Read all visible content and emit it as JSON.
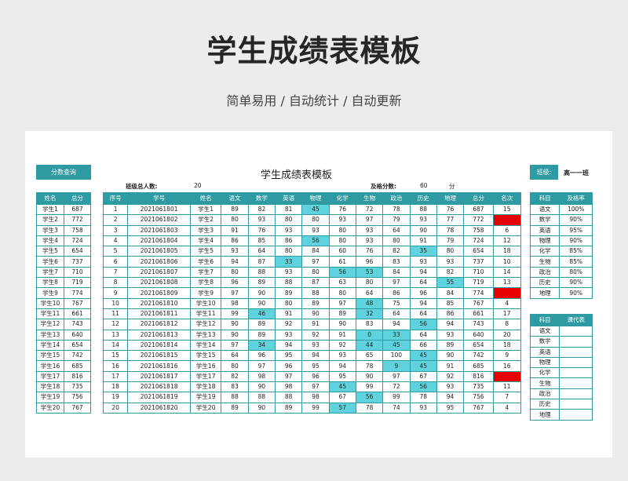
{
  "header": {
    "title": "学生成绩表模板",
    "subtitle": "简单易用  /  自动统计  /  自动更新"
  },
  "sheet": {
    "title": "学生成绩表模板",
    "score_query_button": "分数查询",
    "class_label": "班级:",
    "class_value": "高一一班",
    "total_label": "班级总人数:",
    "total_value": "20",
    "pass_label": "及格分数:",
    "pass_value": "60",
    "pass_unit": "分"
  },
  "left_table": {
    "headers": [
      "姓名",
      "总分"
    ],
    "rows": [
      [
        "学生1",
        "687"
      ],
      [
        "学生2",
        "772"
      ],
      [
        "学生3",
        "758"
      ],
      [
        "学生4",
        "724"
      ],
      [
        "学生5",
        "654"
      ],
      [
        "学生6",
        "737"
      ],
      [
        "学生7",
        "710"
      ],
      [
        "学生8",
        "719"
      ],
      [
        "学生9",
        "774"
      ],
      [
        "学生10",
        "767"
      ],
      [
        "学生11",
        "661"
      ],
      [
        "学生12",
        "743"
      ],
      [
        "学生13",
        "640"
      ],
      [
        "学生14",
        "654"
      ],
      [
        "学生15",
        "742"
      ],
      [
        "学生16",
        "685"
      ],
      [
        "学生17",
        "816"
      ],
      [
        "学生18",
        "735"
      ],
      [
        "学生19",
        "756"
      ],
      [
        "学生20",
        "767"
      ]
    ]
  },
  "main_table": {
    "headers": [
      "序号",
      "学号",
      "姓名",
      "语文",
      "数学",
      "英语",
      "物理",
      "化学",
      "生物",
      "政治",
      "历史",
      "地理",
      "总分",
      "名次"
    ],
    "rows": [
      [
        "1",
        "2021061801",
        "学生1",
        "89",
        "82",
        "81",
        "45",
        "76",
        "72",
        "78",
        "88",
        "76",
        "687",
        "15"
      ],
      [
        "2",
        "2021061802",
        "学生2",
        "80",
        "93",
        "80",
        "80",
        "93",
        "97",
        "79",
        "93",
        "77",
        "772",
        "3"
      ],
      [
        "3",
        "2021061803",
        "学生3",
        "91",
        "76",
        "93",
        "93",
        "80",
        "93",
        "64",
        "90",
        "78",
        "758",
        "6"
      ],
      [
        "4",
        "2021061804",
        "学生4",
        "86",
        "85",
        "86",
        "56",
        "80",
        "93",
        "80",
        "91",
        "79",
        "724",
        "12"
      ],
      [
        "5",
        "2021061805",
        "学生5",
        "93",
        "64",
        "80",
        "84",
        "60",
        "76",
        "82",
        "35",
        "80",
        "654",
        "18"
      ],
      [
        "6",
        "2021061806",
        "学生6",
        "94",
        "87",
        "33",
        "97",
        "61",
        "96",
        "83",
        "93",
        "93",
        "737",
        "10"
      ],
      [
        "7",
        "2021061807",
        "学生7",
        "80",
        "88",
        "93",
        "80",
        "56",
        "53",
        "84",
        "94",
        "82",
        "710",
        "14"
      ],
      [
        "8",
        "2021061808",
        "学生8",
        "96",
        "89",
        "88",
        "87",
        "63",
        "80",
        "97",
        "64",
        "55",
        "719",
        "13"
      ],
      [
        "9",
        "2021061809",
        "学生9",
        "97",
        "90",
        "89",
        "88",
        "80",
        "64",
        "86",
        "96",
        "84",
        "774",
        "2"
      ],
      [
        "10",
        "2021061810",
        "学生10",
        "98",
        "90",
        "80",
        "89",
        "97",
        "48",
        "75",
        "94",
        "85",
        "767",
        "4"
      ],
      [
        "11",
        "2021061811",
        "学生11",
        "99",
        "46",
        "91",
        "90",
        "89",
        "32",
        "64",
        "64",
        "86",
        "661",
        "17"
      ],
      [
        "12",
        "2021061812",
        "学生12",
        "90",
        "89",
        "92",
        "91",
        "90",
        "83",
        "94",
        "56",
        "94",
        "743",
        "8"
      ],
      [
        "13",
        "2021061813",
        "学生13",
        "90",
        "89",
        "93",
        "92",
        "91",
        "0",
        "33",
        "64",
        "93",
        "640",
        "20"
      ],
      [
        "14",
        "2021061814",
        "学生14",
        "97",
        "34",
        "94",
        "93",
        "92",
        "44",
        "45",
        "66",
        "89",
        "654",
        "18"
      ],
      [
        "15",
        "2021061815",
        "学生15",
        "64",
        "96",
        "95",
        "94",
        "93",
        "65",
        "100",
        "45",
        "90",
        "742",
        "9"
      ],
      [
        "16",
        "2021061816",
        "学生16",
        "80",
        "97",
        "96",
        "95",
        "94",
        "78",
        "9",
        "45",
        "91",
        "685",
        "16"
      ],
      [
        "17",
        "2021061817",
        "学生17",
        "82",
        "98",
        "97",
        "96",
        "95",
        "90",
        "97",
        "67",
        "92",
        "816",
        "1"
      ],
      [
        "18",
        "2021061818",
        "学生18",
        "83",
        "90",
        "98",
        "97",
        "45",
        "99",
        "72",
        "56",
        "93",
        "735",
        "11"
      ],
      [
        "19",
        "2021061819",
        "学生19",
        "88",
        "88",
        "88",
        "98",
        "67",
        "56",
        "99",
        "78",
        "94",
        "756",
        "7"
      ],
      [
        "20",
        "2021061820",
        "学生20",
        "89",
        "90",
        "89",
        "99",
        "57",
        "78",
        "74",
        "93",
        "95",
        "767",
        "4"
      ]
    ],
    "highlight": [
      [
        0,
        6
      ],
      [
        3,
        6
      ],
      [
        4,
        10
      ],
      [
        5,
        5
      ],
      [
        6,
        7
      ],
      [
        6,
        8
      ],
      [
        7,
        11
      ],
      [
        9,
        8
      ],
      [
        10,
        4
      ],
      [
        10,
        8
      ],
      [
        11,
        10
      ],
      [
        12,
        8
      ],
      [
        12,
        9
      ],
      [
        13,
        4
      ],
      [
        13,
        8
      ],
      [
        13,
        9
      ],
      [
        14,
        10
      ],
      [
        15,
        9
      ],
      [
        15,
        10
      ],
      [
        17,
        7
      ],
      [
        17,
        10
      ],
      [
        18,
        8
      ],
      [
        19,
        7
      ]
    ],
    "red_rank": [
      1,
      8,
      16
    ]
  },
  "pass_rate_table": {
    "headers": [
      "科目",
      "及格率"
    ],
    "rows": [
      [
        "语文",
        "100%"
      ],
      [
        "数学",
        "90%"
      ],
      [
        "英语",
        "95%"
      ],
      [
        "物理",
        "90%"
      ],
      [
        "化学",
        "85%"
      ],
      [
        "生物",
        "85%"
      ],
      [
        "政治",
        "80%"
      ],
      [
        "历史",
        "90%"
      ],
      [
        "地理",
        "90%"
      ]
    ]
  },
  "teacher_table": {
    "headers": [
      "科目",
      "课代表"
    ],
    "rows": [
      [
        "语文",
        ""
      ],
      [
        "数学",
        ""
      ],
      [
        "英语",
        ""
      ],
      [
        "物理",
        ""
      ],
      [
        "化学",
        ""
      ],
      [
        "生物",
        ""
      ],
      [
        "政治",
        ""
      ],
      [
        "历史",
        ""
      ],
      [
        "地理",
        ""
      ]
    ]
  },
  "colors": {
    "accent": "#2e9ba3",
    "highlight": "#5ed3de",
    "fail_rank": "#e60000"
  }
}
